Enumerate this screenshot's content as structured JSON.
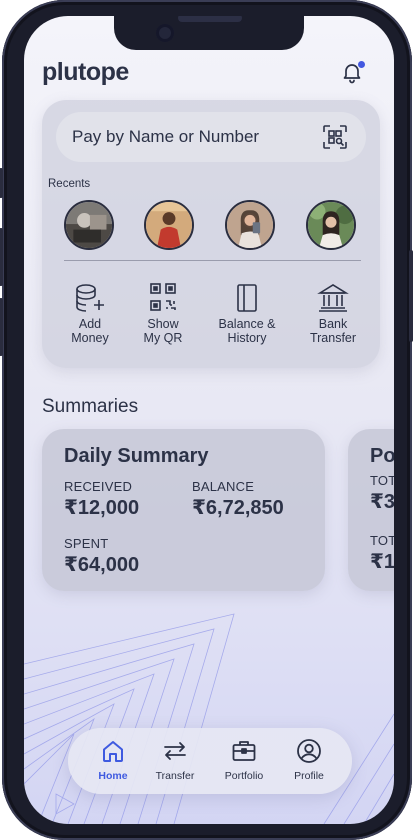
{
  "app": {
    "logo": "plutope"
  },
  "search": {
    "placeholder": "Pay by Name or Number"
  },
  "recents": {
    "label": "Recents",
    "contacts": [
      {
        "name": "contact-1"
      },
      {
        "name": "contact-2"
      },
      {
        "name": "contact-3"
      },
      {
        "name": "contact-4"
      }
    ]
  },
  "actions": [
    {
      "label_line1": "Add",
      "label_line2": "Money",
      "icon": "coins-add-icon"
    },
    {
      "label_line1": "Show",
      "label_line2": "My QR",
      "icon": "qr-code-icon"
    },
    {
      "label_line1": "Balance &",
      "label_line2": "History",
      "icon": "ledger-icon"
    },
    {
      "label_line1": "Bank",
      "label_line2": "Transfer",
      "icon": "bank-icon"
    }
  ],
  "summaries": {
    "title": "Summaries",
    "cards": [
      {
        "title": "Daily Summary",
        "received_label": "RECEIVED",
        "received_value": "₹12,000",
        "balance_label": "BALANCE",
        "balance_value": "₹6,72,850",
        "spent_label": "SPENT",
        "spent_value": "₹64,000"
      },
      {
        "title": "Po",
        "metric1_label": "TOT",
        "metric1_value": "₹3",
        "metric2_label": "TOT",
        "metric2_value": "₹1."
      }
    ]
  },
  "nav": {
    "items": [
      {
        "label": "Home",
        "icon": "home-icon",
        "active": true
      },
      {
        "label": "Transfer",
        "icon": "transfer-arrows-icon",
        "active": false
      },
      {
        "label": "Portfolio",
        "icon": "briefcase-icon",
        "active": false
      },
      {
        "label": "Profile",
        "icon": "user-circle-icon",
        "active": false
      }
    ]
  },
  "colors": {
    "accent": "#3f5ae0",
    "text": "#2c3247",
    "notification_dot": "#4358e0"
  }
}
